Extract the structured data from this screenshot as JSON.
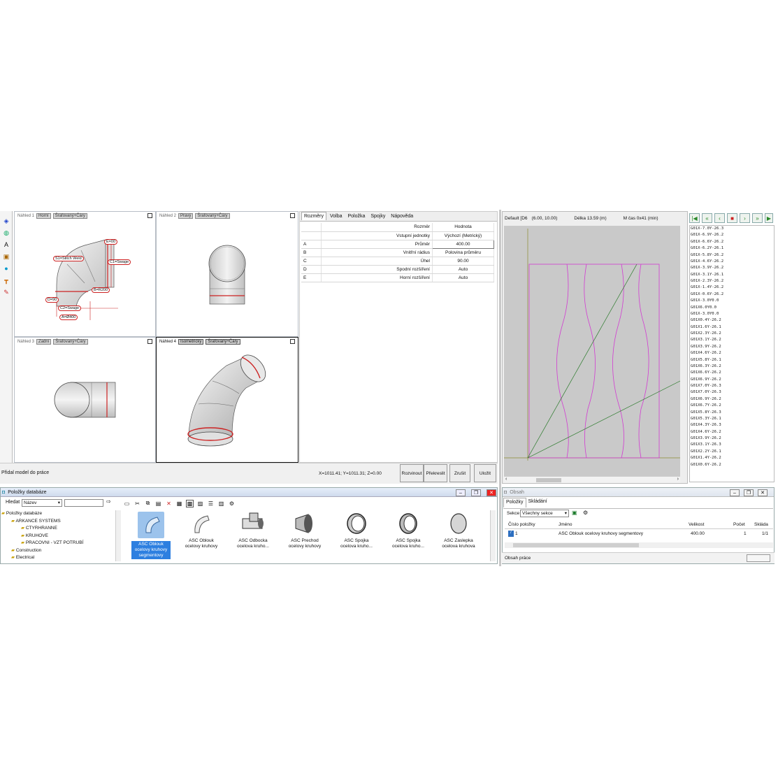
{
  "left_toolbar": {
    "icons": [
      "cube-icon",
      "globe-icon",
      "text-icon",
      "image-icon",
      "sphere-icon",
      "tee-icon",
      "paint-icon"
    ]
  },
  "viewports": [
    {
      "label": "Náhled 1",
      "view": "Horní",
      "mode": "Šrafovaný+Čáry"
    },
    {
      "label": "Náhled 2",
      "view": "Pravý",
      "mode": "Šrafovaný+Čáry"
    },
    {
      "label": "Náhled 3",
      "view": "Zadní",
      "mode": "Šrafovaný+Čáry"
    },
    {
      "label": "Náhled 4",
      "view": "Isometrický",
      "mode": "Šrafovaný+Čáry"
    }
  ],
  "annotations": {
    "e": "E=00",
    "s1": "S1=Stitch Weld",
    "c1": "C1=Swage",
    "b": "B=R200",
    "d": "D=90",
    "c2": "C2=Swage",
    "a": "A=Ø400"
  },
  "props": {
    "tabs": [
      "Rozměry",
      "Volba",
      "Položka",
      "Spojky",
      "Nápověda"
    ],
    "col_size": "Rozměr",
    "col_value": "Hodnota",
    "rows": [
      {
        "key": "",
        "name": "Vstupní jednotky",
        "value": "Výchozí (Metrický)"
      },
      {
        "key": "A",
        "name": "Průměr",
        "value": "400.00"
      },
      {
        "key": "B",
        "name": "Vnitřní rádius",
        "value": "Polovina průměru"
      },
      {
        "key": "C",
        "name": "Úhel",
        "value": "90.00"
      },
      {
        "key": "D",
        "name": "Spodní rozšíření",
        "value": "Auto"
      },
      {
        "key": "E",
        "name": "Horní rozšíření",
        "value": "Auto"
      }
    ]
  },
  "status": {
    "message": "Přidal model do práce",
    "coords": "X=1011.41; Y=1011.31; Z=0.00"
  },
  "buttons": {
    "unfold": "Rozvinout",
    "redraw": "Překreslit",
    "cancel": "Zrušit",
    "save": "Uložit"
  },
  "nest": {
    "sheet": "Default [D6",
    "size": "(6.00, 10.00)",
    "length": "Délka 13.59 (m)",
    "time": "M čas 0x41 (min)"
  },
  "gcode": [
    "G01X-7.0Y-26.3",
    "G01X-6.9Y-26.2",
    "G01X-6.6Y-26.2",
    "G01X-6.2Y-26.1",
    "G01X-5.8Y-26.2",
    "G01X-4.6Y-26.2",
    "G01X-3.9Y-26.2",
    "G01X-3.1Y-26.1",
    "G01X-2.3Y-26.2",
    "G01X-1.4Y-26.2",
    "G01X-0.6Y-26.2",
    "G01X-3.0Y0.0",
    "G01X6.0Y0.0",
    "G01X-3.0Y0.0",
    "G01X0.4Y-26.2",
    "G01X1.6Y-26.1",
    "G01X2.3Y-26.2",
    "G01X3.1Y-26.2",
    "G01X3.9Y-26.2",
    "G01X4.6Y-26.2",
    "G01X5.8Y-26.1",
    "G01X6.3Y-26.2",
    "G01X6.6Y-26.2",
    "G01X6.9Y-26.2",
    "G01X7.0Y-26.3",
    "G01X7.0Y-26.3",
    "G01X6.9Y-26.2",
    "G01X6.7Y-26.2",
    "G01X5.8Y-26.3",
    "G01X5.3Y-26.1",
    "G01X4.3Y-26.3",
    "G01X4.6Y-26.2",
    "G01X3.9Y-26.2",
    "G01X3.1Y-26.3",
    "G01X2.2Y-26.1",
    "G01X1.4Y-26.2",
    "G01X0.6Y-26.2"
  ],
  "db": {
    "title": "Položky databáze",
    "search_label": "Hledat",
    "search_mode": "Název",
    "tree": [
      "Položky databáze",
      "ARKANCE SYSTEMS",
      "CTYRHRANNE",
      "KRUHOVE",
      "PRACOVNI - VZT POTRUBÍ",
      "Construction",
      "Electrical"
    ],
    "items": [
      {
        "line1": "ASC Oblouk",
        "line2": "ocelovy kruhovy",
        "line3": "segmentovy"
      },
      {
        "line1": "ASC Oblouk",
        "line2": "ocelovy kruhovy",
        "line3": ""
      },
      {
        "line1": "ASC Odbocka",
        "line2": "ocelova kruho...",
        "line3": ""
      },
      {
        "line1": "ASC Prechod",
        "line2": "ocelovy kruhovy",
        "line3": ""
      },
      {
        "line1": "ASC Spojka",
        "line2": "ocelova kruho...",
        "line3": ""
      },
      {
        "line1": "ASC Spojka",
        "line2": "ocelova kruho...",
        "line3": ""
      },
      {
        "line1": "ASC Zaslepka",
        "line2": "ocelova kruhova",
        "line3": ""
      }
    ]
  },
  "contents": {
    "title": "Obsah",
    "tabs": [
      "Položky",
      "Skládání"
    ],
    "section_label": "Sekce",
    "section_value": "Všechny sekce",
    "headers": [
      "Číslo položky",
      "Jméno",
      "Velikost",
      "Počet",
      "Skláda"
    ],
    "row": {
      "number": "1",
      "name": "ASC Oblouk ocelovy kruhovy segmentovy",
      "size": "400.00",
      "count": "1",
      "stack": "1/1"
    },
    "footer": "Obsah práce"
  }
}
